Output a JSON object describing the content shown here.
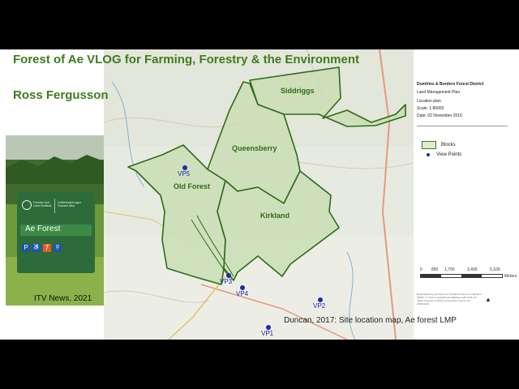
{
  "slide": {
    "title": "Forest of Ae VLOG for Farming, Forestry & the Environment",
    "author": "Ross Fergusson",
    "photo_credit": "ITV News, 2021",
    "map_credit": "Duncan, 2017: Site location map, Ae forest LMP"
  },
  "photo_sign": {
    "agency_line1": "Forestry and Land Scotland",
    "agency_line2": "Coilltearachd agus Fearann Alba",
    "name": "Ae Forest",
    "icons": [
      "P",
      "toilet",
      "7",
      "cycle"
    ]
  },
  "map": {
    "blocks": [
      "Siddriggs",
      "Queensberry",
      "Old Forest",
      "Kirkland"
    ],
    "viewpoints": [
      "VP1",
      "VP2",
      "VP3",
      "VP4",
      "VP5"
    ]
  },
  "legend": {
    "org": "Dumfries & Borders Forest District",
    "plan": "Land Management Plan",
    "subtitle": "Location plan",
    "scale": "Scale: 1:80000",
    "date": "Date: 02 November 2016",
    "blocks_label": "Blocks",
    "viewpoints_label": "View Points",
    "scale_ticks": [
      "0",
      "850",
      "1,700",
      "3,400",
      "5,100"
    ],
    "scale_unit": "Meters",
    "fine_print": "Reproduced by permission of Ordnance Survey on behalf of HMSO. © Crown copyright and database right 2016. All rights reserved. Forestry Commission Licence No. 100021242"
  },
  "colors": {
    "title": "#3e7d1d",
    "block_outline": "#2f6b1a",
    "viewpoint": "#1b2aa8"
  }
}
